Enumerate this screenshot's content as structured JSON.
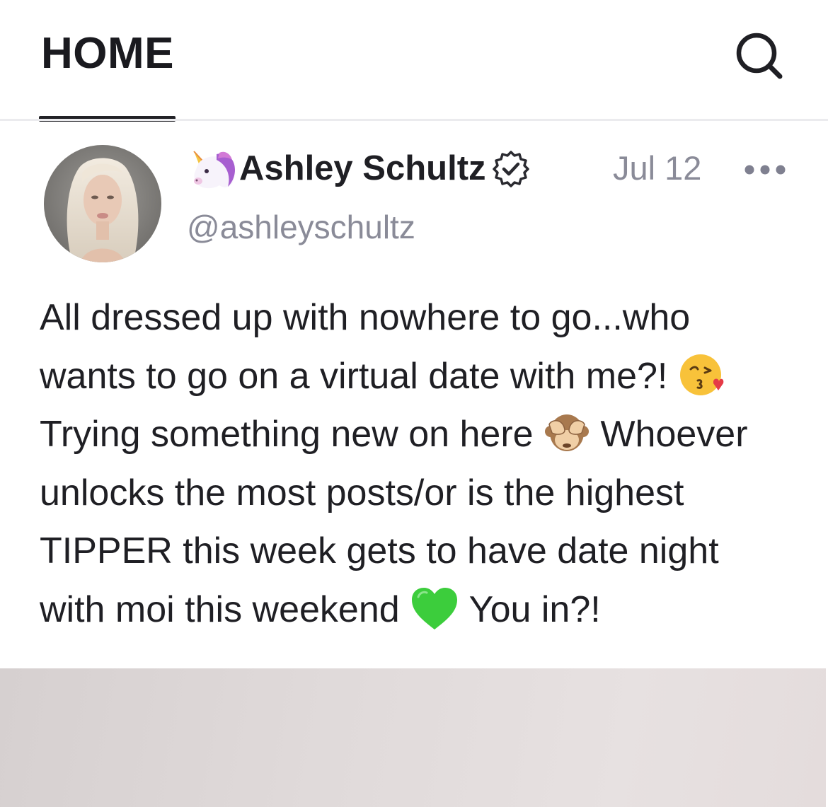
{
  "header": {
    "tab_label": "HOME",
    "search_icon": "search-icon"
  },
  "post": {
    "author": {
      "emoji_icon": "unicorn-emoji",
      "name": "Ashley Schultz",
      "verified_icon": "verified-badge-icon",
      "handle": "@ashleyschultz"
    },
    "date": "Jul 12",
    "more_icon": "more-options-icon",
    "text": {
      "line1": "All dressed up with nowhere to go...who",
      "line2_a": "wants to go on a virtual date with me?!",
      "line2_emoji": "face-blowing-a-kiss-emoji",
      "line3_a": "Trying something new on here",
      "line3_emoji": "see-no-evil-monkey-emoji",
      "line3_b": "Whoever",
      "line4": "unlocks the most posts/or is the highest",
      "line5": "TIPPER this week gets to have date night",
      "line6_a": "with moi this weekend",
      "line6_emoji": "green-heart-emoji",
      "line6_b": "You in?!"
    },
    "media": "post-image"
  },
  "colors": {
    "text_primary": "#1f1f24",
    "text_secondary": "#8a8b98",
    "tab_indicator": "#222227",
    "divider": "#ebebee"
  }
}
